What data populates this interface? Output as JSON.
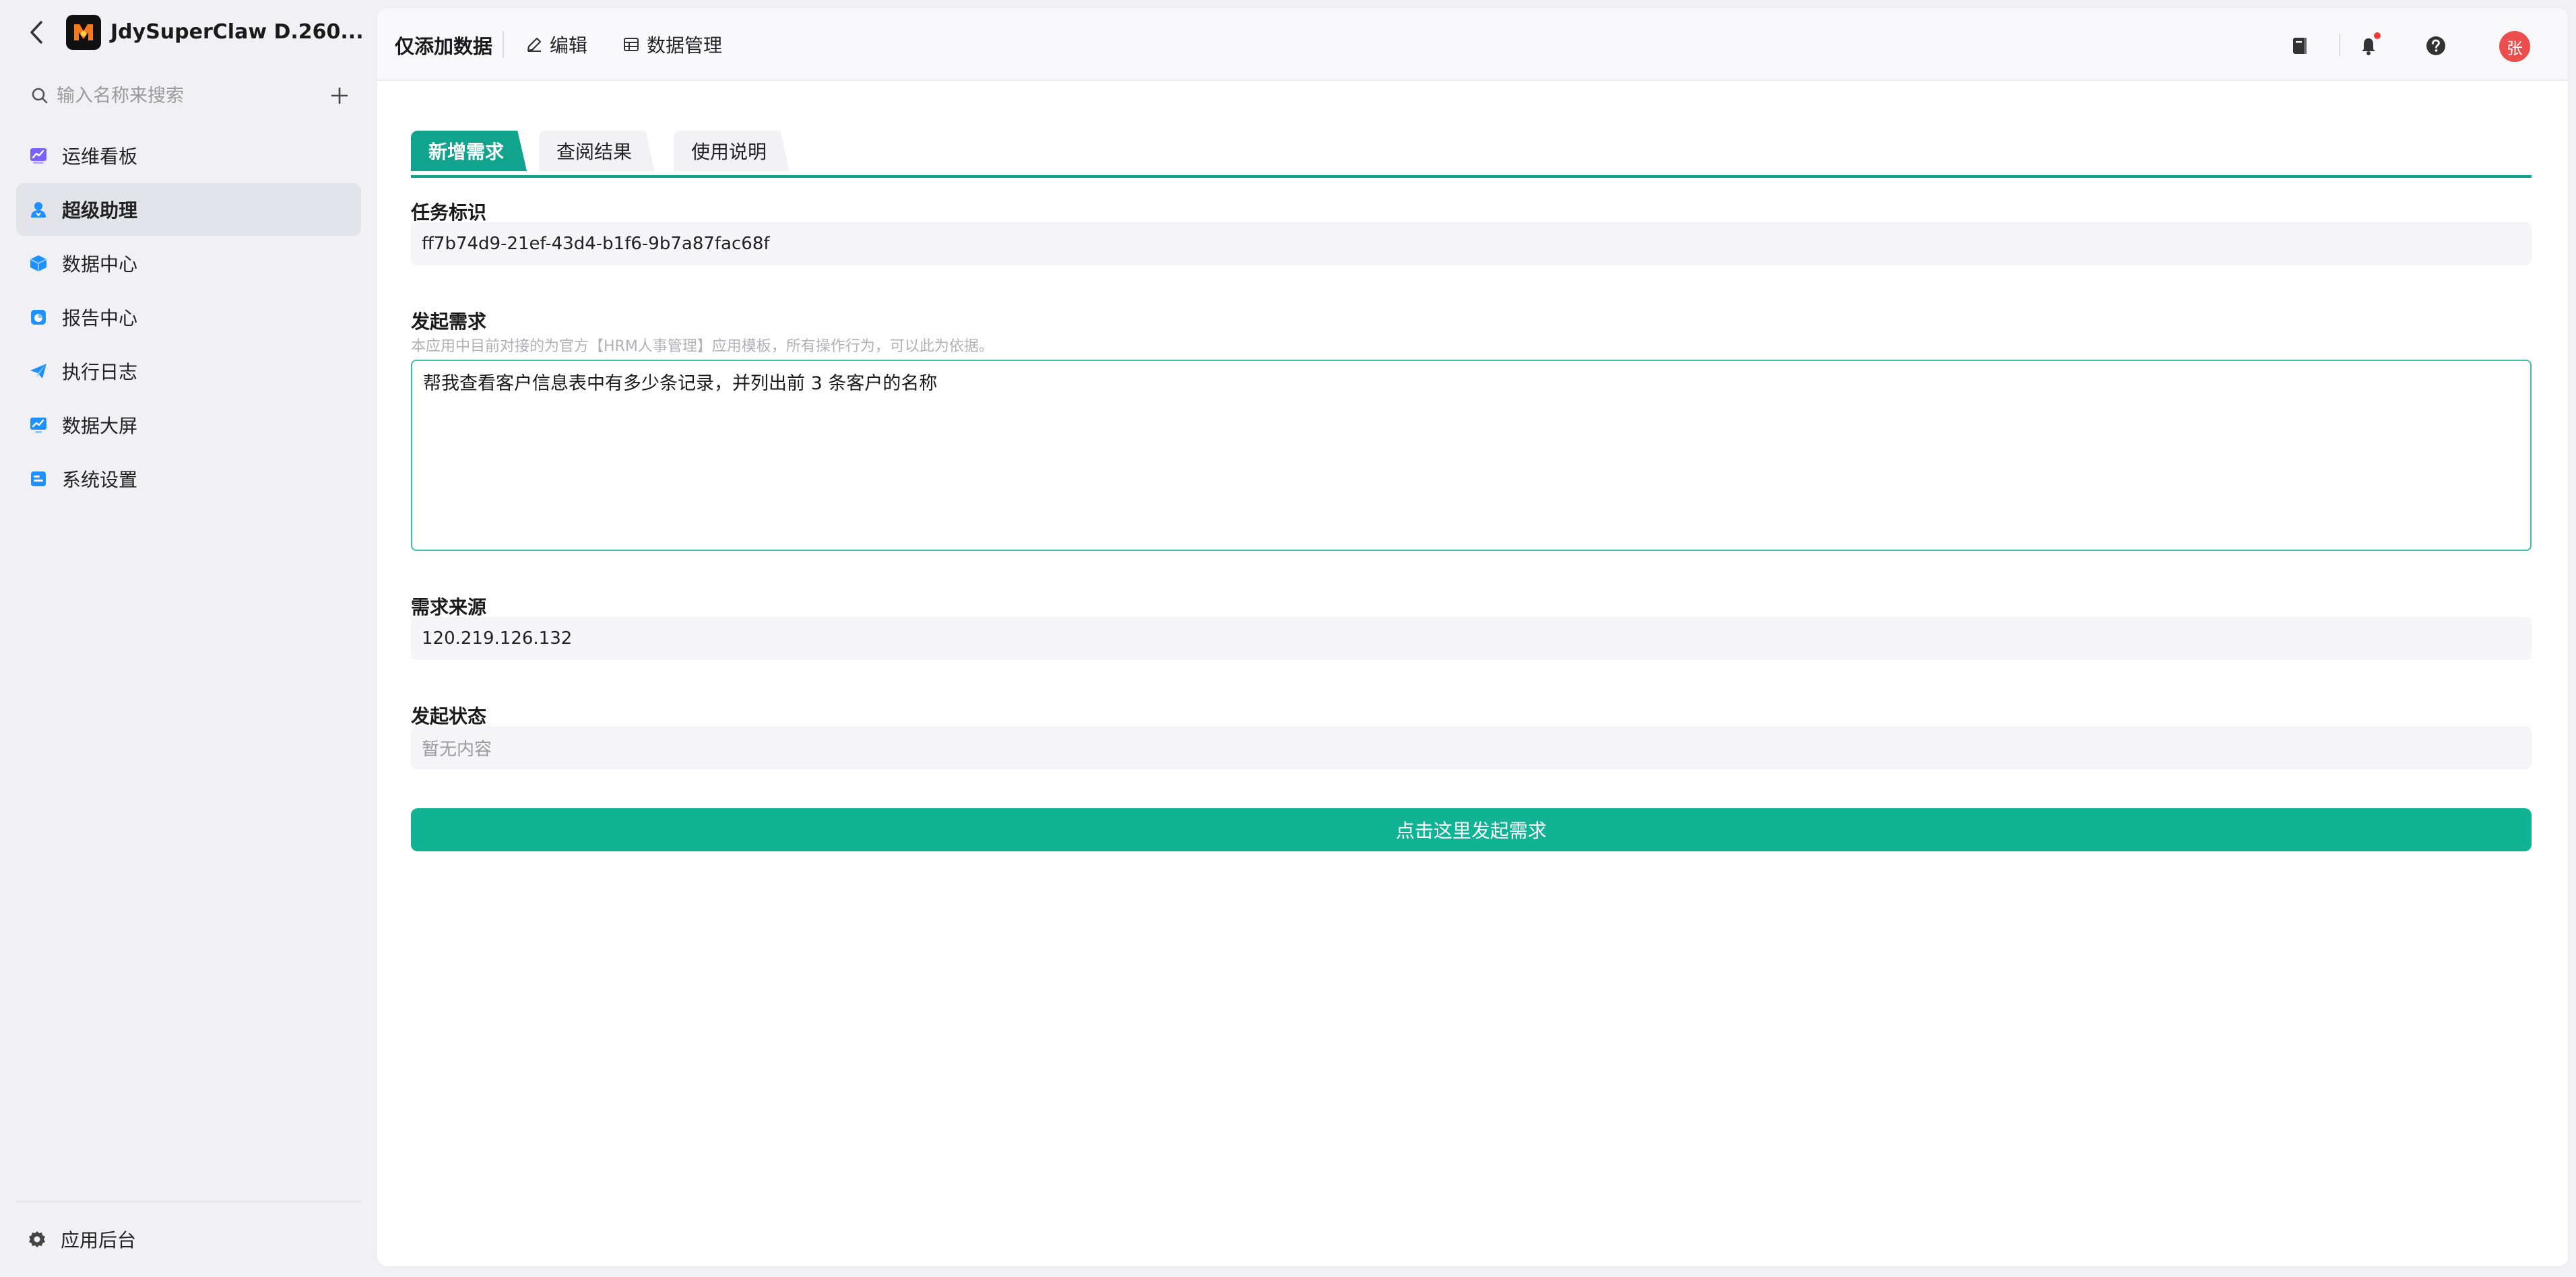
{
  "app": {
    "title": "JdySuperClaw D.260..."
  },
  "sidebar": {
    "search_placeholder": "输入名称来搜索",
    "items": [
      {
        "label": "运维看板",
        "icon": "dashboard-chart-icon",
        "color": "#7b61ff"
      },
      {
        "label": "超级助理",
        "icon": "assistant-user-icon",
        "color": "#1e90ff",
        "active": true
      },
      {
        "label": "数据中心",
        "icon": "data-cube-icon",
        "color": "#1e90ff"
      },
      {
        "label": "报告中心",
        "icon": "report-icon",
        "color": "#1e90ff"
      },
      {
        "label": "执行日志",
        "icon": "send-plane-icon",
        "color": "#1e90ff"
      },
      {
        "label": "数据大屏",
        "icon": "screen-chart-icon",
        "color": "#1e90ff"
      },
      {
        "label": "系统设置",
        "icon": "settings-doc-icon",
        "color": "#1e90ff"
      }
    ],
    "footer_label": "应用后台"
  },
  "topbar": {
    "title": "仅添加数据",
    "edit_label": "编辑",
    "data_manage_label": "数据管理",
    "avatar_text": "张"
  },
  "tabs": [
    {
      "label": "新增需求",
      "active": true
    },
    {
      "label": "查阅结果",
      "active": false
    },
    {
      "label": "使用说明",
      "active": false
    }
  ],
  "form": {
    "task_id_label": "任务标识",
    "task_id_value": "ff7b74d9-21ef-43d4-b1f6-9b7a87fac68f",
    "request_label": "发起需求",
    "request_hint": "本应用中目前对接的为官方【HRM人事管理】应用模板，所有操作行为，可以此为依据。",
    "request_value": "帮我查看客户信息表中有多少条记录，并列出前 3 条客户的名称",
    "source_label": "需求来源",
    "source_value": "120.219.126.132",
    "status_label": "发起状态",
    "status_value": "暂无内容",
    "submit_label": "点击这里发起需求"
  },
  "colors": {
    "accent": "#10a48f",
    "button": "#10b495",
    "avatar": "#ec4d4d"
  }
}
